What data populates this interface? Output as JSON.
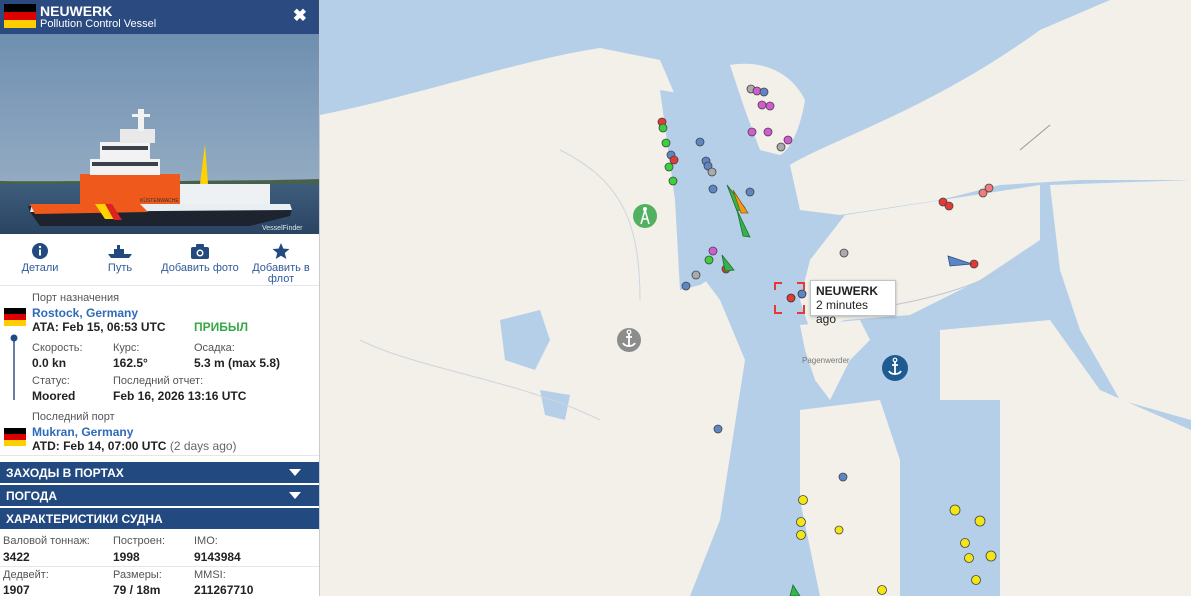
{
  "vessel": {
    "name": "NEUWERK",
    "type": "Pollution Control Vessel",
    "close_label": "✖",
    "photo_watermark": "VesselFinder",
    "hull_text": "KÜSTENWACHE"
  },
  "actions": [
    {
      "label": "Детали",
      "icon": "info-icon"
    },
    {
      "label": "Путь",
      "icon": "ship-track-icon"
    },
    {
      "label": "Добавить фото",
      "icon": "camera-icon"
    },
    {
      "label": "Добавить в флот",
      "icon": "star-icon"
    }
  ],
  "destination": {
    "caption": "Порт назначения",
    "port": "Rostock, Germany",
    "ata": "ATA: Feb 15, 06:53 UTC",
    "status_badge": "ПРИБЫЛ"
  },
  "voyage": {
    "speed_label": "Скорость:",
    "speed_value": "0.0 kn",
    "course_label": "Курс:",
    "course_value": "162.5°",
    "draught_label": "Осадка:",
    "draught_value": "5.3 m (max 5.8)",
    "status_label": "Статус:",
    "status_value": "Moored",
    "report_label": "Последний отчет:",
    "report_value": "Feb 16, 2026 13:16 UTC"
  },
  "last_port": {
    "caption": "Последний порт",
    "port": "Mukran, Germany",
    "atd": "ATD: Feb 14, 07:00 UTC",
    "ago": "(2 days ago)"
  },
  "sections": [
    {
      "label": "ЗАХОДЫ В ПОРТАХ",
      "expandable": true
    },
    {
      "label": "ПОГОДА",
      "expandable": true
    },
    {
      "label": "ХАРАКТЕРИСТИКИ СУДНА",
      "expandable": false
    }
  ],
  "specs": {
    "gt_label": "Валовой тоннаж:",
    "gt_value": "3422",
    "built_label": "Построен:",
    "built_value": "1998",
    "imo_label": "IMO:",
    "imo_value": "9143984",
    "dwt_label": "Дедвейт:",
    "dwt_value": "1907",
    "size_label": "Размеры:",
    "size_value": "79 / 18m",
    "mmsi_label": "MMSI:",
    "mmsi_value": "211267710"
  },
  "map": {
    "popup_title": "NEUWERK",
    "popup_subtitle": "2 minutes ago",
    "place_label": "Pagenwerder",
    "colors": {
      "water": "#b5cfe9",
      "land": "#f3f1ea",
      "badge": "#ffffff"
    }
  }
}
